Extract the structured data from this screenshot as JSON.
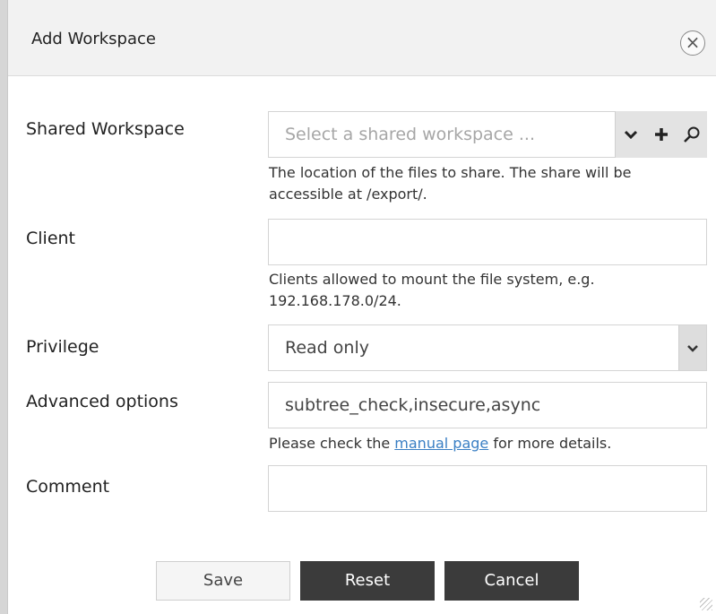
{
  "dialog": {
    "title": "Add Workspace",
    "close_symbol": "×"
  },
  "fields": {
    "shared_workspace": {
      "label": "Shared Workspace",
      "placeholder": "Select a shared workspace ...",
      "help": "The location of the files to share. The share will be accessible at /export/.",
      "icons": [
        "chevron-down-icon",
        "plus-icon",
        "search-icon"
      ]
    },
    "client": {
      "label": "Client",
      "value": "",
      "help": "Clients allowed to mount the file system, e.g. 192.168.178.0/24."
    },
    "privilege": {
      "label": "Privilege",
      "value": "Read only"
    },
    "advanced_options": {
      "label": "Advanced options",
      "value": "subtree_check,insecure,async",
      "help_prefix": "Please check the ",
      "help_link": "manual page",
      "help_suffix": " for more details."
    },
    "comment": {
      "label": "Comment",
      "value": ""
    }
  },
  "buttons": {
    "save": "Save",
    "reset": "Reset",
    "cancel": "Cancel"
  },
  "colors": {
    "primary_button": "#3b3b3b",
    "link": "#3a7fc4"
  }
}
